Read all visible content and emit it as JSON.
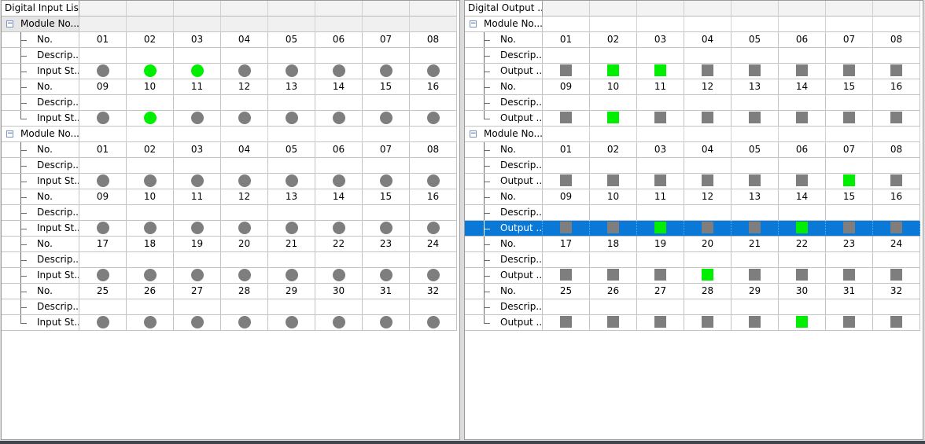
{
  "panels": [
    {
      "id": "input",
      "title": "Digital Input List",
      "indicator": "circle",
      "status_label": "Input St...",
      "modules": [
        {
          "label": "Module No...",
          "groups": [
            {
              "numbers": [
                "01",
                "02",
                "03",
                "04",
                "05",
                "06",
                "07",
                "08"
              ],
              "states": [
                0,
                1,
                1,
                0,
                0,
                0,
                0,
                0
              ]
            },
            {
              "numbers": [
                "09",
                "10",
                "11",
                "12",
                "13",
                "14",
                "15",
                "16"
              ],
              "states": [
                0,
                1,
                0,
                0,
                0,
                0,
                0,
                0
              ]
            }
          ]
        },
        {
          "label": "Module No...",
          "groups": [
            {
              "numbers": [
                "01",
                "02",
                "03",
                "04",
                "05",
                "06",
                "07",
                "08"
              ],
              "states": [
                0,
                0,
                0,
                0,
                0,
                0,
                0,
                0
              ]
            },
            {
              "numbers": [
                "09",
                "10",
                "11",
                "12",
                "13",
                "14",
                "15",
                "16"
              ],
              "states": [
                0,
                0,
                0,
                0,
                0,
                0,
                0,
                0
              ]
            },
            {
              "numbers": [
                "17",
                "18",
                "19",
                "20",
                "21",
                "22",
                "23",
                "24"
              ],
              "states": [
                0,
                0,
                0,
                0,
                0,
                0,
                0,
                0
              ]
            },
            {
              "numbers": [
                "25",
                "26",
                "27",
                "28",
                "29",
                "30",
                "31",
                "32"
              ],
              "states": [
                0,
                0,
                0,
                0,
                0,
                0,
                0,
                0
              ]
            }
          ]
        }
      ]
    },
    {
      "id": "output",
      "title": "Digital Output ...",
      "indicator": "square",
      "status_label": "Output ...",
      "modules": [
        {
          "label": "Module No...",
          "groups": [
            {
              "numbers": [
                "01",
                "02",
                "03",
                "04",
                "05",
                "06",
                "07",
                "08"
              ],
              "states": [
                0,
                1,
                1,
                0,
                0,
                0,
                0,
                0
              ]
            },
            {
              "numbers": [
                "09",
                "10",
                "11",
                "12",
                "13",
                "14",
                "15",
                "16"
              ],
              "states": [
                0,
                1,
                0,
                0,
                0,
                0,
                0,
                0
              ]
            }
          ]
        },
        {
          "label": "Module No...",
          "groups": [
            {
              "numbers": [
                "01",
                "02",
                "03",
                "04",
                "05",
                "06",
                "07",
                "08"
              ],
              "states": [
                0,
                0,
                0,
                0,
                0,
                0,
                1,
                0
              ]
            },
            {
              "numbers": [
                "09",
                "10",
                "11",
                "12",
                "13",
                "14",
                "15",
                "16"
              ],
              "states": [
                0,
                0,
                1,
                0,
                0,
                1,
                0,
                0
              ],
              "selected": true
            },
            {
              "numbers": [
                "17",
                "18",
                "19",
                "20",
                "21",
                "22",
                "23",
                "24"
              ],
              "states": [
                0,
                0,
                0,
                1,
                0,
                0,
                0,
                0
              ]
            },
            {
              "numbers": [
                "25",
                "26",
                "27",
                "28",
                "29",
                "30",
                "31",
                "32"
              ],
              "states": [
                0,
                0,
                0,
                0,
                0,
                1,
                0,
                0
              ]
            }
          ]
        }
      ]
    }
  ],
  "row_labels": {
    "number": "No.",
    "description": "Descrip..."
  },
  "expander_symbol": "−",
  "colors": {
    "on": "#00ee00",
    "off": "#7e7e7e",
    "selection": "#0a78d7"
  }
}
